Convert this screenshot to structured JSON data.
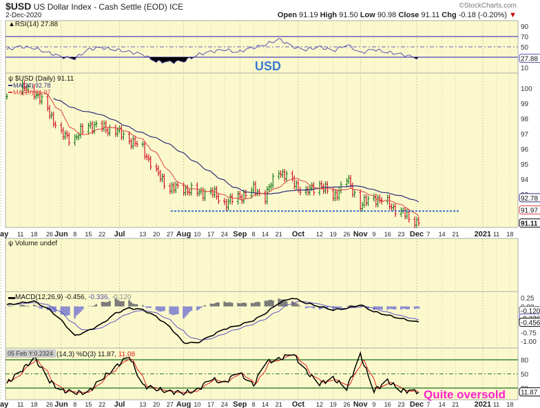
{
  "header": {
    "symbol": "$USD",
    "name": "US Dollar Index - Cash Settle (EOD)",
    "exchange": "ICE",
    "date": "2-Dec-2020",
    "brand": "©StockCharts.com",
    "open_label": "Open",
    "open": "91.19",
    "high_label": "High",
    "high": "91.50",
    "low_label": "Low",
    "low": "90.98",
    "close_label": "Close",
    "close": "91.11",
    "chg_label": "Chg",
    "chg": "-0.18 (-0.20%)",
    "chg_arrow": "▼"
  },
  "annotations": {
    "usd": "USD",
    "oversold": "Quite oversold"
  },
  "colors": {
    "panel": "#fbf9cc",
    "up": "#1a7a1a",
    "down": "#d0102a",
    "ma34": "#2c2c7a",
    "ma10": "#e04040",
    "rsi": "#5550b0",
    "support": "#3a6fd0",
    "stoch_line": "#2a7a2a",
    "annot_usd": "#3a78d0",
    "annot_oversold": "#ff22cc"
  },
  "chart_data": [
    {
      "type": "line",
      "title": "RSI(14) 27.88",
      "panel": "rsi",
      "yticks": [
        "90",
        "70",
        "50",
        "10"
      ],
      "ytick_values": [
        90,
        70,
        50,
        10
      ],
      "last_label": "27.88",
      "levels": [
        70,
        50,
        30
      ],
      "values": [
        45,
        50,
        48,
        38,
        30,
        28,
        45,
        48,
        45,
        40,
        35,
        22,
        20,
        22,
        35,
        40,
        45,
        40,
        48,
        55,
        65,
        50,
        45,
        50,
        42,
        55,
        38,
        45,
        40,
        35,
        28
      ]
    },
    {
      "type": "ohlc",
      "title": "$USD (Daily) 91.11",
      "panel": "price",
      "legend": [
        {
          "name": "MA(34) 92.78",
          "color": "#2c2c7a"
        },
        {
          "name": "MA(10) 91.97",
          "color": "#e04040"
        }
      ],
      "yticks": [
        "100",
        "99",
        "98",
        "97",
        "96",
        "95",
        "94",
        "93"
      ],
      "ytick_values": [
        100,
        99,
        98,
        97,
        96,
        95,
        94,
        93
      ],
      "last_labels": [
        "92.78",
        "91.97",
        "91.11"
      ],
      "support_level": 91.9,
      "dates": [
        "2020-05-04",
        "2020-05-11",
        "2020-05-18",
        "2020-05-26",
        "2020-06-01",
        "2020-06-08",
        "2020-06-15",
        "2020-06-22",
        "2020-06-29",
        "2020-07-06",
        "2020-07-13",
        "2020-07-20",
        "2020-07-27",
        "2020-08-03",
        "2020-08-10",
        "2020-08-17",
        "2020-08-24",
        "2020-08-31",
        "2020-09-08",
        "2020-09-14",
        "2020-09-21",
        "2020-09-28",
        "2020-10-05",
        "2020-10-12",
        "2020-10-19",
        "2020-10-26",
        "2020-11-02",
        "2020-11-09",
        "2020-11-16",
        "2020-11-23",
        "2020-12-02"
      ],
      "closes": [
        99.3,
        100.0,
        99.8,
        98.4,
        96.9,
        96.7,
        97.6,
        97.4,
        97.2,
        96.6,
        96.0,
        94.4,
        93.4,
        93.4,
        93.1,
        93.2,
        92.4,
        92.8,
        93.3,
        92.9,
        94.6,
        93.8,
        93.1,
        93.7,
        92.8,
        94.0,
        92.3,
        92.8,
        92.4,
        91.8,
        91.11
      ]
    },
    {
      "type": "bar",
      "title": "Volume undef",
      "panel": "volume"
    },
    {
      "type": "line",
      "title": "MACD(12,26,9) -0.456, -0.336, -0.120",
      "title_parts": [
        "MACD(12,26,9) -0.456,",
        "-0.336,",
        "-0.120"
      ],
      "panel": "macd",
      "yticks": [
        "0.25",
        "0.00",
        "-0.75",
        "-1.00"
      ],
      "ytick_values": [
        0.25,
        0,
        -0.75,
        -1
      ],
      "last_labels": [
        "-0.120",
        "-0.336",
        "-0.456"
      ],
      "values": [
        0.05,
        0.1,
        0.15,
        -0.1,
        -0.4,
        -0.85,
        -0.7,
        -0.5,
        -0.2,
        -0.05,
        -0.1,
        -0.3,
        -0.6,
        -1.05,
        -1.05,
        -0.85,
        -0.65,
        -0.55,
        -0.4,
        -0.2,
        0.1,
        0.25,
        0.1,
        0.0,
        -0.1,
        -0.05,
        0.05,
        -0.15,
        -0.25,
        -0.35,
        -0.456
      ]
    },
    {
      "type": "line",
      "title": "(14,3) %D(3) 11.87,",
      "title_red": "11.08",
      "cursor": "05 Feb Y:0.2324",
      "panel": "stoch",
      "yticks": [
        "80",
        "50",
        "20"
      ],
      "ytick_values": [
        80,
        50,
        20
      ],
      "last_label": "11.87",
      "levels": [
        80,
        50,
        20
      ],
      "values": [
        30,
        55,
        85,
        35,
        15,
        10,
        12,
        40,
        65,
        88,
        25,
        18,
        12,
        10,
        15,
        40,
        30,
        55,
        25,
        75,
        80,
        95,
        55,
        30,
        40,
        20,
        90,
        15,
        35,
        15,
        12
      ]
    }
  ],
  "xaxis": {
    "labels": [
      "May",
      "11",
      "18",
      "26",
      "Jun",
      "8",
      "15",
      "22",
      "Jul",
      "13",
      "20",
      "27",
      "Aug",
      "10",
      "17",
      "24",
      "Sep",
      "8",
      "14",
      "21",
      "Oct",
      "12",
      "19",
      "26",
      "Nov",
      "9",
      "16",
      "23",
      "Dec",
      "7",
      "14",
      "21",
      "2021",
      "11",
      "18"
    ],
    "dates": [
      "2020-05-01",
      "2020-05-11",
      "2020-05-18",
      "2020-05-26",
      "2020-06-01",
      "2020-06-08",
      "2020-06-15",
      "2020-06-22",
      "2020-07-01",
      "2020-07-13",
      "2020-07-20",
      "2020-07-27",
      "2020-08-03",
      "2020-08-10",
      "2020-08-17",
      "2020-08-24",
      "2020-09-01",
      "2020-09-08",
      "2020-09-14",
      "2020-09-21",
      "2020-10-01",
      "2020-10-12",
      "2020-10-19",
      "2020-10-26",
      "2020-11-02",
      "2020-11-09",
      "2020-11-16",
      "2020-11-23",
      "2020-12-01",
      "2020-12-07",
      "2020-12-14",
      "2020-12-21",
      "2021-01-04",
      "2021-01-11",
      "2021-01-18"
    ],
    "major": [
      "May",
      "Jun",
      "Jul",
      "Aug",
      "Sep",
      "Oct",
      "Nov",
      "Dec",
      "2021"
    ]
  }
}
